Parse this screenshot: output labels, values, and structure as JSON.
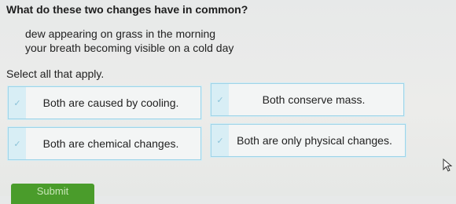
{
  "question": "What do these two changes have in common?",
  "changes": [
    "dew appearing on grass in the morning",
    "your breath becoming visible on a cold day"
  ],
  "instruction": "Select all that apply.",
  "choices": [
    {
      "label": "Both are caused by cooling.",
      "check_icon": "check-icon"
    },
    {
      "label": "Both conserve mass.",
      "check_icon": "check-icon"
    },
    {
      "label": "Both are chemical changes.",
      "check_icon": "check-icon"
    },
    {
      "label": "Both are only physical changes.",
      "check_icon": "check-icon"
    }
  ],
  "submit_label": "Submit",
  "colors": {
    "choice_border": "#9fd4e8",
    "submit_bg": "#4a9c2b"
  }
}
